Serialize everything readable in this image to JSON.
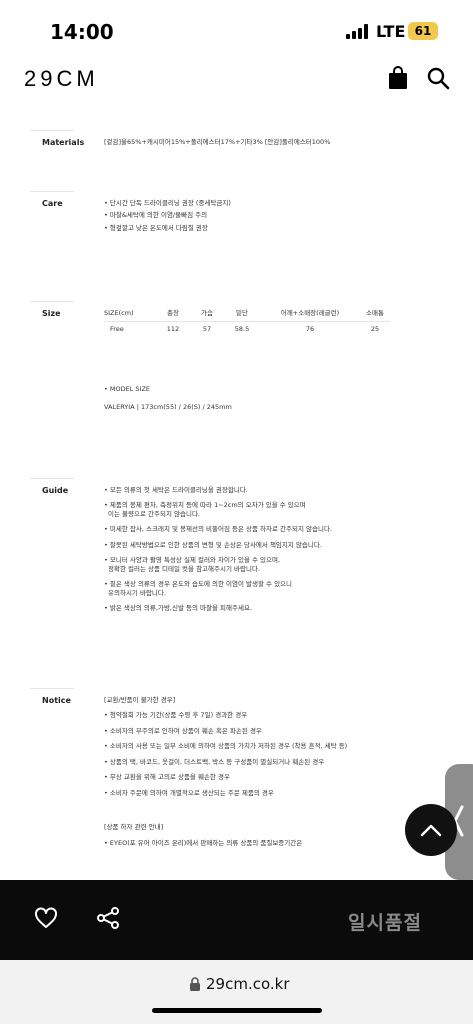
{
  "status": {
    "time": "14:00",
    "network": "LTE",
    "battery": "61"
  },
  "header": {
    "logo": "29CM",
    "icons": [
      "shopping-bag-icon",
      "search-icon"
    ]
  },
  "materials": {
    "label": "Materials",
    "text": "[겉감]울65%+캐시미어15%+폴리에스터17%+기타3% [안감]폴리에스터100%"
  },
  "care": {
    "label": "Care",
    "items": [
      "• 단시간 단독 드라이클리닝 권장 (중세탁금지)",
      "• 마찰&세탁에 의한 이염/물빠짐 주의",
      "• 형겊깔고 낮은 온도에서 다림질 권장"
    ]
  },
  "size": {
    "label": "Size",
    "headers": [
      "SIZE(cm)",
      "총장",
      "가슴",
      "밑단",
      "어깨+소매장(레글런)",
      "소매통"
    ],
    "rows": [
      [
        "Free",
        "112",
        "57",
        "58.5",
        "76",
        "25"
      ]
    ],
    "model_title": "• MODEL SIZE",
    "model_text": "VALERYIA | 173cm(55) / 26(S) / 245mm"
  },
  "guide": {
    "label": "Guide",
    "items": [
      [
        "• 모든 의류의 첫 세탁은 드라이클리닝을 권장합니다."
      ],
      [
        "• 제품의 봉제 편차, 측정위치 등에 따라 1~2cm의 오차가 있을 수 있으며",
        "이는 불량으로 간주되지 않습니다."
      ],
      [
        "• 미세한 잡사, 스크래치 및 봉제선의 비뚤어짐 등은 상품 하자로 간주되지 않습니다."
      ],
      [
        "• 잘못된 세탁방법으로 인한 상품의 변형 및 손상은 당사에서 책임지지 않습니다."
      ],
      [
        "• 모니터 사양과 촬영 특성상 실제 컬러와 차이가 있을 수 있으며,",
        "정확한 컬러는 상품 디테일 컷을 참고해주시기 바랍니다."
      ],
      [
        "• 짙은 색상 의류의 경우 온도와 습도에 의한 이염이 발생할 수 있으니",
        "유의하시기 바랍니다."
      ],
      [
        "• 밝은 색상의 의류,가방,신발 등의 마찰을 피해주세요."
      ]
    ]
  },
  "notice": {
    "label": "Notice",
    "heading": "[교환/반품이 불가한 경우]",
    "items": [
      "• 청약철회 가능 기간(상품 수령 후 7일) 경과한 경우",
      "• 소비자의 부주의로 인하여 상품이 훼손 혹은 파손된 경우",
      "• 소비자의 사용 또는 일부 소비에 의하여 상품의 가치가 저하된 경우 (착용 흔적, 세탁 등)",
      "• 상품의 택, 바코드, 옷걸이, 더스트백, 박스 등 구성품이 멸실되거나 훼손된 경우",
      "• 무상 교환을 위해 고의로 상품을 훼손한 경우",
      "• 소비자 주문에 의하여 개별적으로 생산되는 주문 제품의 경우"
    ],
    "heading2": "[상품 하자 관련 안내]",
    "item2": "• EYEO(포 유어 아이즈 온리)에서 판매하는 의류 상품의 품질보증기간은"
  },
  "bottom": {
    "soldout_label": "일시품절"
  },
  "browser": {
    "url": "29cm.co.kr"
  }
}
